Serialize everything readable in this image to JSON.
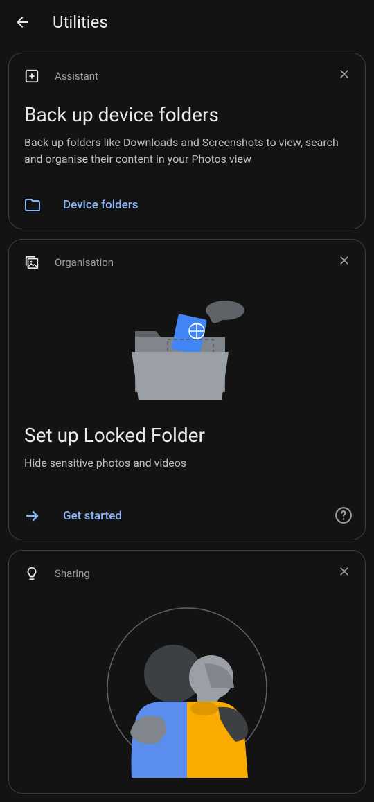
{
  "header": {
    "title": "Utilities"
  },
  "cards": {
    "assistant": {
      "category": "Assistant",
      "title": "Back up device folders",
      "description": "Back up folders like Downloads and Screenshots to view, search and organise their content in your Photos view",
      "action_label": "Device folders"
    },
    "organisation": {
      "category": "Organisation",
      "title": "Set up Locked Folder",
      "description": "Hide sensitive photos and videos",
      "action_label": "Get started"
    },
    "sharing": {
      "category": "Sharing"
    }
  }
}
